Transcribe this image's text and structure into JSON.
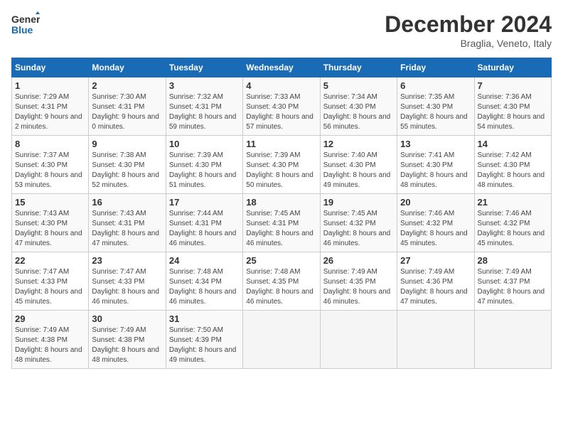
{
  "header": {
    "logo_line1": "General",
    "logo_line2": "Blue",
    "month": "December 2024",
    "location": "Braglia, Veneto, Italy"
  },
  "days_of_week": [
    "Sunday",
    "Monday",
    "Tuesday",
    "Wednesday",
    "Thursday",
    "Friday",
    "Saturday"
  ],
  "weeks": [
    [
      {
        "day": "1",
        "sunrise": "Sunrise: 7:29 AM",
        "sunset": "Sunset: 4:31 PM",
        "daylight": "Daylight: 9 hours and 2 minutes."
      },
      {
        "day": "2",
        "sunrise": "Sunrise: 7:30 AM",
        "sunset": "Sunset: 4:31 PM",
        "daylight": "Daylight: 9 hours and 0 minutes."
      },
      {
        "day": "3",
        "sunrise": "Sunrise: 7:32 AM",
        "sunset": "Sunset: 4:31 PM",
        "daylight": "Daylight: 8 hours and 59 minutes."
      },
      {
        "day": "4",
        "sunrise": "Sunrise: 7:33 AM",
        "sunset": "Sunset: 4:30 PM",
        "daylight": "Daylight: 8 hours and 57 minutes."
      },
      {
        "day": "5",
        "sunrise": "Sunrise: 7:34 AM",
        "sunset": "Sunset: 4:30 PM",
        "daylight": "Daylight: 8 hours and 56 minutes."
      },
      {
        "day": "6",
        "sunrise": "Sunrise: 7:35 AM",
        "sunset": "Sunset: 4:30 PM",
        "daylight": "Daylight: 8 hours and 55 minutes."
      },
      {
        "day": "7",
        "sunrise": "Sunrise: 7:36 AM",
        "sunset": "Sunset: 4:30 PM",
        "daylight": "Daylight: 8 hours and 54 minutes."
      }
    ],
    [
      {
        "day": "8",
        "sunrise": "Sunrise: 7:37 AM",
        "sunset": "Sunset: 4:30 PM",
        "daylight": "Daylight: 8 hours and 53 minutes."
      },
      {
        "day": "9",
        "sunrise": "Sunrise: 7:38 AM",
        "sunset": "Sunset: 4:30 PM",
        "daylight": "Daylight: 8 hours and 52 minutes."
      },
      {
        "day": "10",
        "sunrise": "Sunrise: 7:39 AM",
        "sunset": "Sunset: 4:30 PM",
        "daylight": "Daylight: 8 hours and 51 minutes."
      },
      {
        "day": "11",
        "sunrise": "Sunrise: 7:39 AM",
        "sunset": "Sunset: 4:30 PM",
        "daylight": "Daylight: 8 hours and 50 minutes."
      },
      {
        "day": "12",
        "sunrise": "Sunrise: 7:40 AM",
        "sunset": "Sunset: 4:30 PM",
        "daylight": "Daylight: 8 hours and 49 minutes."
      },
      {
        "day": "13",
        "sunrise": "Sunrise: 7:41 AM",
        "sunset": "Sunset: 4:30 PM",
        "daylight": "Daylight: 8 hours and 48 minutes."
      },
      {
        "day": "14",
        "sunrise": "Sunrise: 7:42 AM",
        "sunset": "Sunset: 4:30 PM",
        "daylight": "Daylight: 8 hours and 48 minutes."
      }
    ],
    [
      {
        "day": "15",
        "sunrise": "Sunrise: 7:43 AM",
        "sunset": "Sunset: 4:30 PM",
        "daylight": "Daylight: 8 hours and 47 minutes."
      },
      {
        "day": "16",
        "sunrise": "Sunrise: 7:43 AM",
        "sunset": "Sunset: 4:31 PM",
        "daylight": "Daylight: 8 hours and 47 minutes."
      },
      {
        "day": "17",
        "sunrise": "Sunrise: 7:44 AM",
        "sunset": "Sunset: 4:31 PM",
        "daylight": "Daylight: 8 hours and 46 minutes."
      },
      {
        "day": "18",
        "sunrise": "Sunrise: 7:45 AM",
        "sunset": "Sunset: 4:31 PM",
        "daylight": "Daylight: 8 hours and 46 minutes."
      },
      {
        "day": "19",
        "sunrise": "Sunrise: 7:45 AM",
        "sunset": "Sunset: 4:32 PM",
        "daylight": "Daylight: 8 hours and 46 minutes."
      },
      {
        "day": "20",
        "sunrise": "Sunrise: 7:46 AM",
        "sunset": "Sunset: 4:32 PM",
        "daylight": "Daylight: 8 hours and 45 minutes."
      },
      {
        "day": "21",
        "sunrise": "Sunrise: 7:46 AM",
        "sunset": "Sunset: 4:32 PM",
        "daylight": "Daylight: 8 hours and 45 minutes."
      }
    ],
    [
      {
        "day": "22",
        "sunrise": "Sunrise: 7:47 AM",
        "sunset": "Sunset: 4:33 PM",
        "daylight": "Daylight: 8 hours and 45 minutes."
      },
      {
        "day": "23",
        "sunrise": "Sunrise: 7:47 AM",
        "sunset": "Sunset: 4:33 PM",
        "daylight": "Daylight: 8 hours and 46 minutes."
      },
      {
        "day": "24",
        "sunrise": "Sunrise: 7:48 AM",
        "sunset": "Sunset: 4:34 PM",
        "daylight": "Daylight: 8 hours and 46 minutes."
      },
      {
        "day": "25",
        "sunrise": "Sunrise: 7:48 AM",
        "sunset": "Sunset: 4:35 PM",
        "daylight": "Daylight: 8 hours and 46 minutes."
      },
      {
        "day": "26",
        "sunrise": "Sunrise: 7:49 AM",
        "sunset": "Sunset: 4:35 PM",
        "daylight": "Daylight: 8 hours and 46 minutes."
      },
      {
        "day": "27",
        "sunrise": "Sunrise: 7:49 AM",
        "sunset": "Sunset: 4:36 PM",
        "daylight": "Daylight: 8 hours and 47 minutes."
      },
      {
        "day": "28",
        "sunrise": "Sunrise: 7:49 AM",
        "sunset": "Sunset: 4:37 PM",
        "daylight": "Daylight: 8 hours and 47 minutes."
      }
    ],
    [
      {
        "day": "29",
        "sunrise": "Sunrise: 7:49 AM",
        "sunset": "Sunset: 4:38 PM",
        "daylight": "Daylight: 8 hours and 48 minutes."
      },
      {
        "day": "30",
        "sunrise": "Sunrise: 7:49 AM",
        "sunset": "Sunset: 4:38 PM",
        "daylight": "Daylight: 8 hours and 48 minutes."
      },
      {
        "day": "31",
        "sunrise": "Sunrise: 7:50 AM",
        "sunset": "Sunset: 4:39 PM",
        "daylight": "Daylight: 8 hours and 49 minutes."
      },
      null,
      null,
      null,
      null
    ]
  ]
}
